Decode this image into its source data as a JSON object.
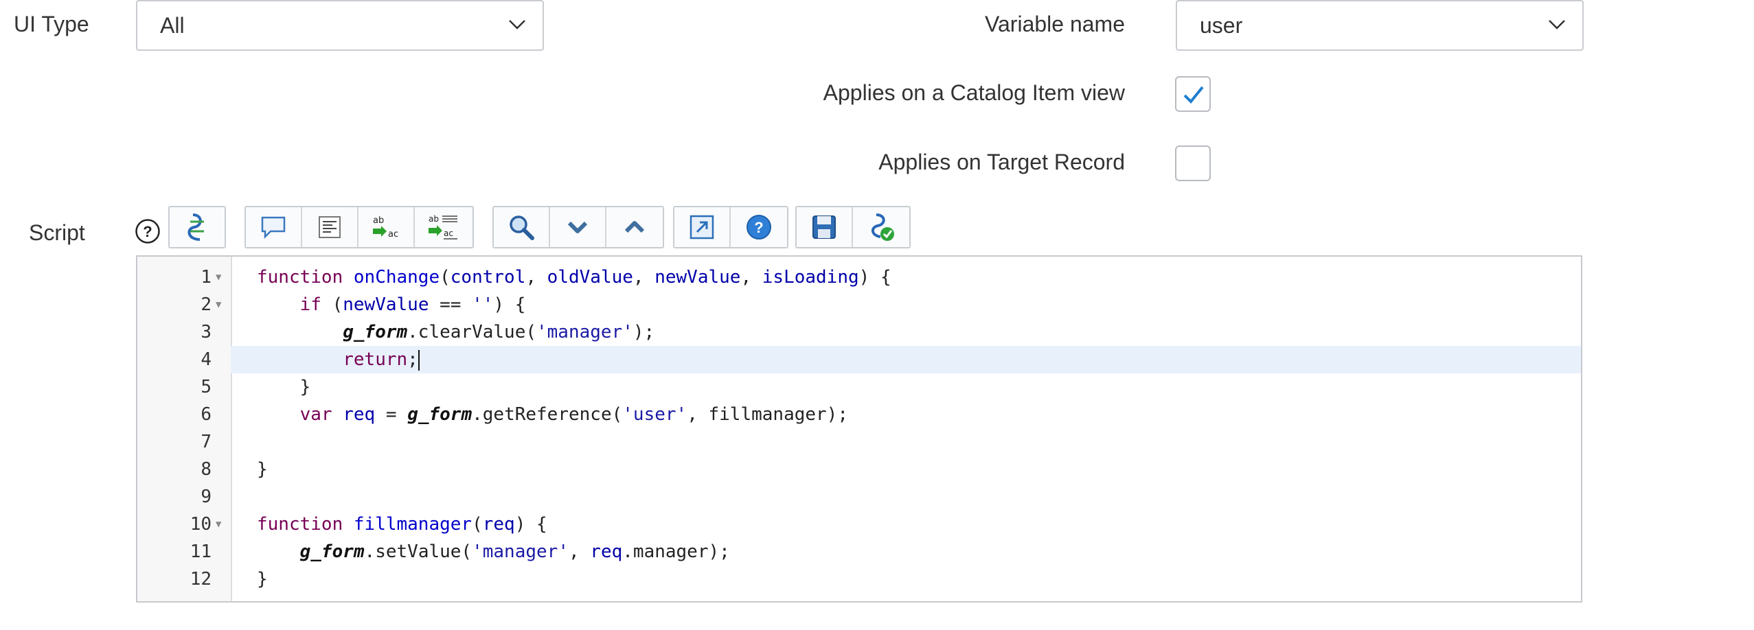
{
  "fields": {
    "ui_type": {
      "label": "UI Type",
      "value": "All"
    },
    "variable_name": {
      "label": "Variable name",
      "value": "user"
    },
    "applies_catalog": {
      "label": "Applies on a Catalog Item view",
      "checked": true
    },
    "applies_target": {
      "label": "Applies on Target Record",
      "checked": false
    },
    "script": {
      "label": "Script"
    }
  },
  "toolbar_icons": [
    [
      "script-format-icon"
    ],
    [
      "comment-icon",
      "format-code-icon",
      "replace-icon",
      "replace-all-icon"
    ],
    [
      "search-icon",
      "next-icon",
      "previous-icon"
    ],
    [
      "fullscreen-icon",
      "help-icon"
    ],
    [
      "save-icon",
      "script-debug-icon"
    ]
  ],
  "code": {
    "line_numbers": [
      "1",
      "2",
      "3",
      "4",
      "5",
      "6",
      "7",
      "8",
      "9",
      "10",
      "11",
      "12"
    ],
    "lines": [
      "function onChange(control, oldValue, newValue, isLoading) {",
      "    if (newValue == '') {",
      "        g_form.clearValue('manager');",
      "        return;",
      "    }",
      "    var req = g_form.getReference('user', fillmanager);",
      "",
      "}",
      "",
      "function fillmanager(req) {",
      "    g_form.setValue('manager', req.manager);",
      "}"
    ],
    "active_line": 4
  },
  "colors": {
    "checkbox_accent": "#1f7ed0"
  }
}
